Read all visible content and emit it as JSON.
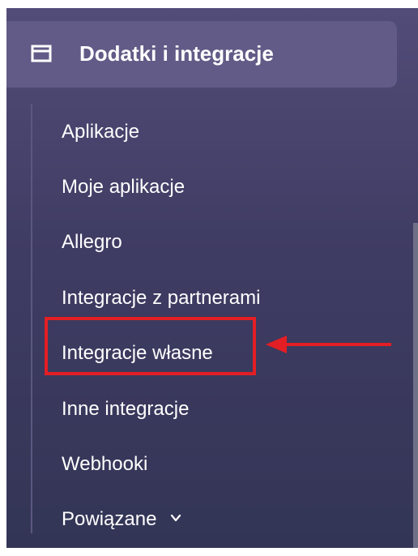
{
  "sidebar": {
    "section": {
      "title": "Dodatki i integracje",
      "icon": "window-icon"
    },
    "items": [
      {
        "label": "Aplikacje"
      },
      {
        "label": "Moje aplikacje"
      },
      {
        "label": "Allegro"
      },
      {
        "label": "Integracje z partnerami"
      },
      {
        "label": "Integracje własne",
        "highlighted": true
      },
      {
        "label": "Inne integracje"
      },
      {
        "label": "Webhooki"
      },
      {
        "label": "Powiązane",
        "expandable": true,
        "icon": "chevron-down-icon"
      }
    ]
  },
  "annotation": {
    "highlight_color": "#e31e24",
    "arrow_icon": "arrow-left-icon"
  },
  "colors": {
    "sidebar_bg": "#433f68",
    "section_bg": "#625b87",
    "text": "#ffffff",
    "accent_red": "#e31e24"
  }
}
